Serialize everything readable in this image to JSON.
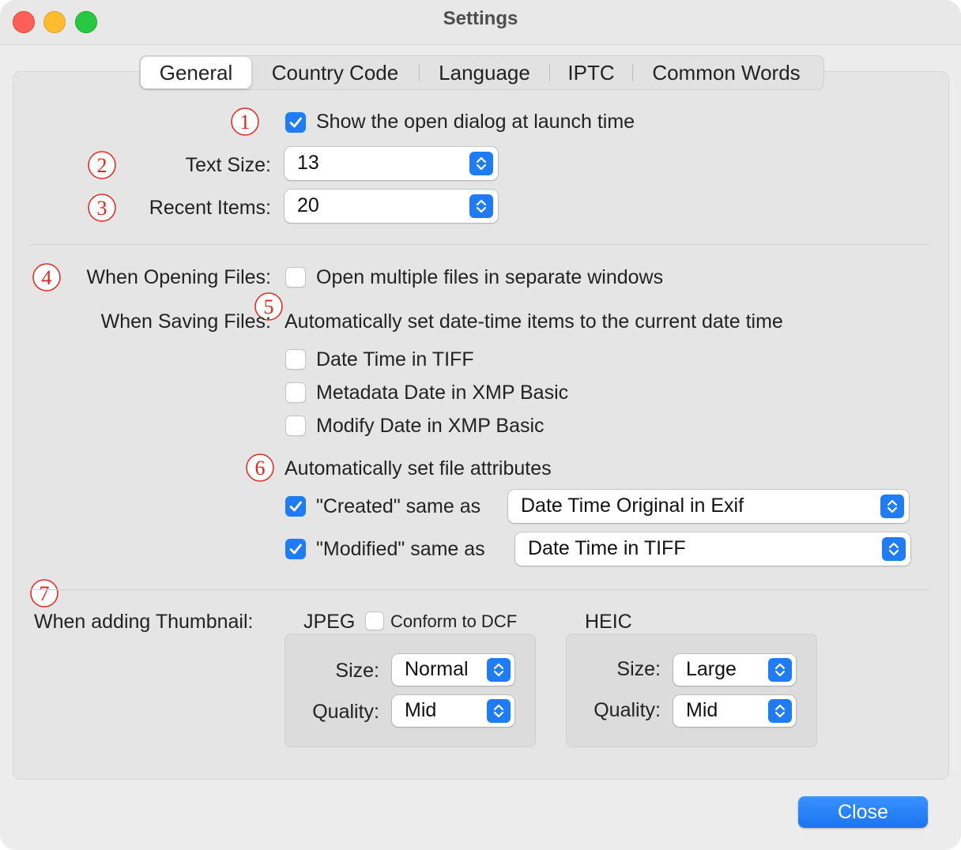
{
  "window": {
    "title": "Settings"
  },
  "tabs": [
    {
      "label": "General",
      "selected": true
    },
    {
      "label": "Country Code",
      "selected": false
    },
    {
      "label": "Language",
      "selected": false
    },
    {
      "label": "IPTC",
      "selected": false
    },
    {
      "label": "Common Words",
      "selected": false
    }
  ],
  "annotations": [
    "①",
    "②",
    "③",
    "④",
    "⑤",
    "⑥",
    "⑦"
  ],
  "general": {
    "open_dialog": {
      "label": "Show the open dialog at launch time",
      "checked": true
    },
    "text_size": {
      "label": "Text Size:",
      "value": "13"
    },
    "recent_items": {
      "label": "Recent Items:",
      "value": "20"
    }
  },
  "opening": {
    "label": "When Opening Files:",
    "separate_windows": {
      "label": "Open multiple files in separate windows",
      "checked": false
    }
  },
  "saving": {
    "label": "When Saving Files:",
    "datetime_heading": "Automatically set date-time items to the current date time",
    "options": [
      {
        "label": "Date Time in TIFF",
        "checked": false
      },
      {
        "label": "Metadata Date in XMP Basic",
        "checked": false
      },
      {
        "label": "Modify Date in XMP Basic",
        "checked": false
      }
    ],
    "attributes_heading": "Automatically set file attributes",
    "created": {
      "label": "\"Created\" same as",
      "checked": true,
      "value": "Date Time Original in Exif"
    },
    "modified": {
      "label": "\"Modified\" same as",
      "checked": true,
      "value": "Date Time in TIFF"
    }
  },
  "thumbnail": {
    "label": "When adding Thumbnail:",
    "jpeg": {
      "title": "JPEG",
      "conform_label": "Conform to DCF",
      "conform_checked": false,
      "size_label": "Size:",
      "size_value": "Normal",
      "quality_label": "Quality:",
      "quality_value": "Mid"
    },
    "heic": {
      "title": "HEIC",
      "size_label": "Size:",
      "size_value": "Large",
      "quality_label": "Quality:",
      "quality_value": "Mid"
    }
  },
  "footer": {
    "close_label": "Close"
  },
  "colors": {
    "accent": "#1f7cf4",
    "annotation_red": "#e0281b"
  }
}
